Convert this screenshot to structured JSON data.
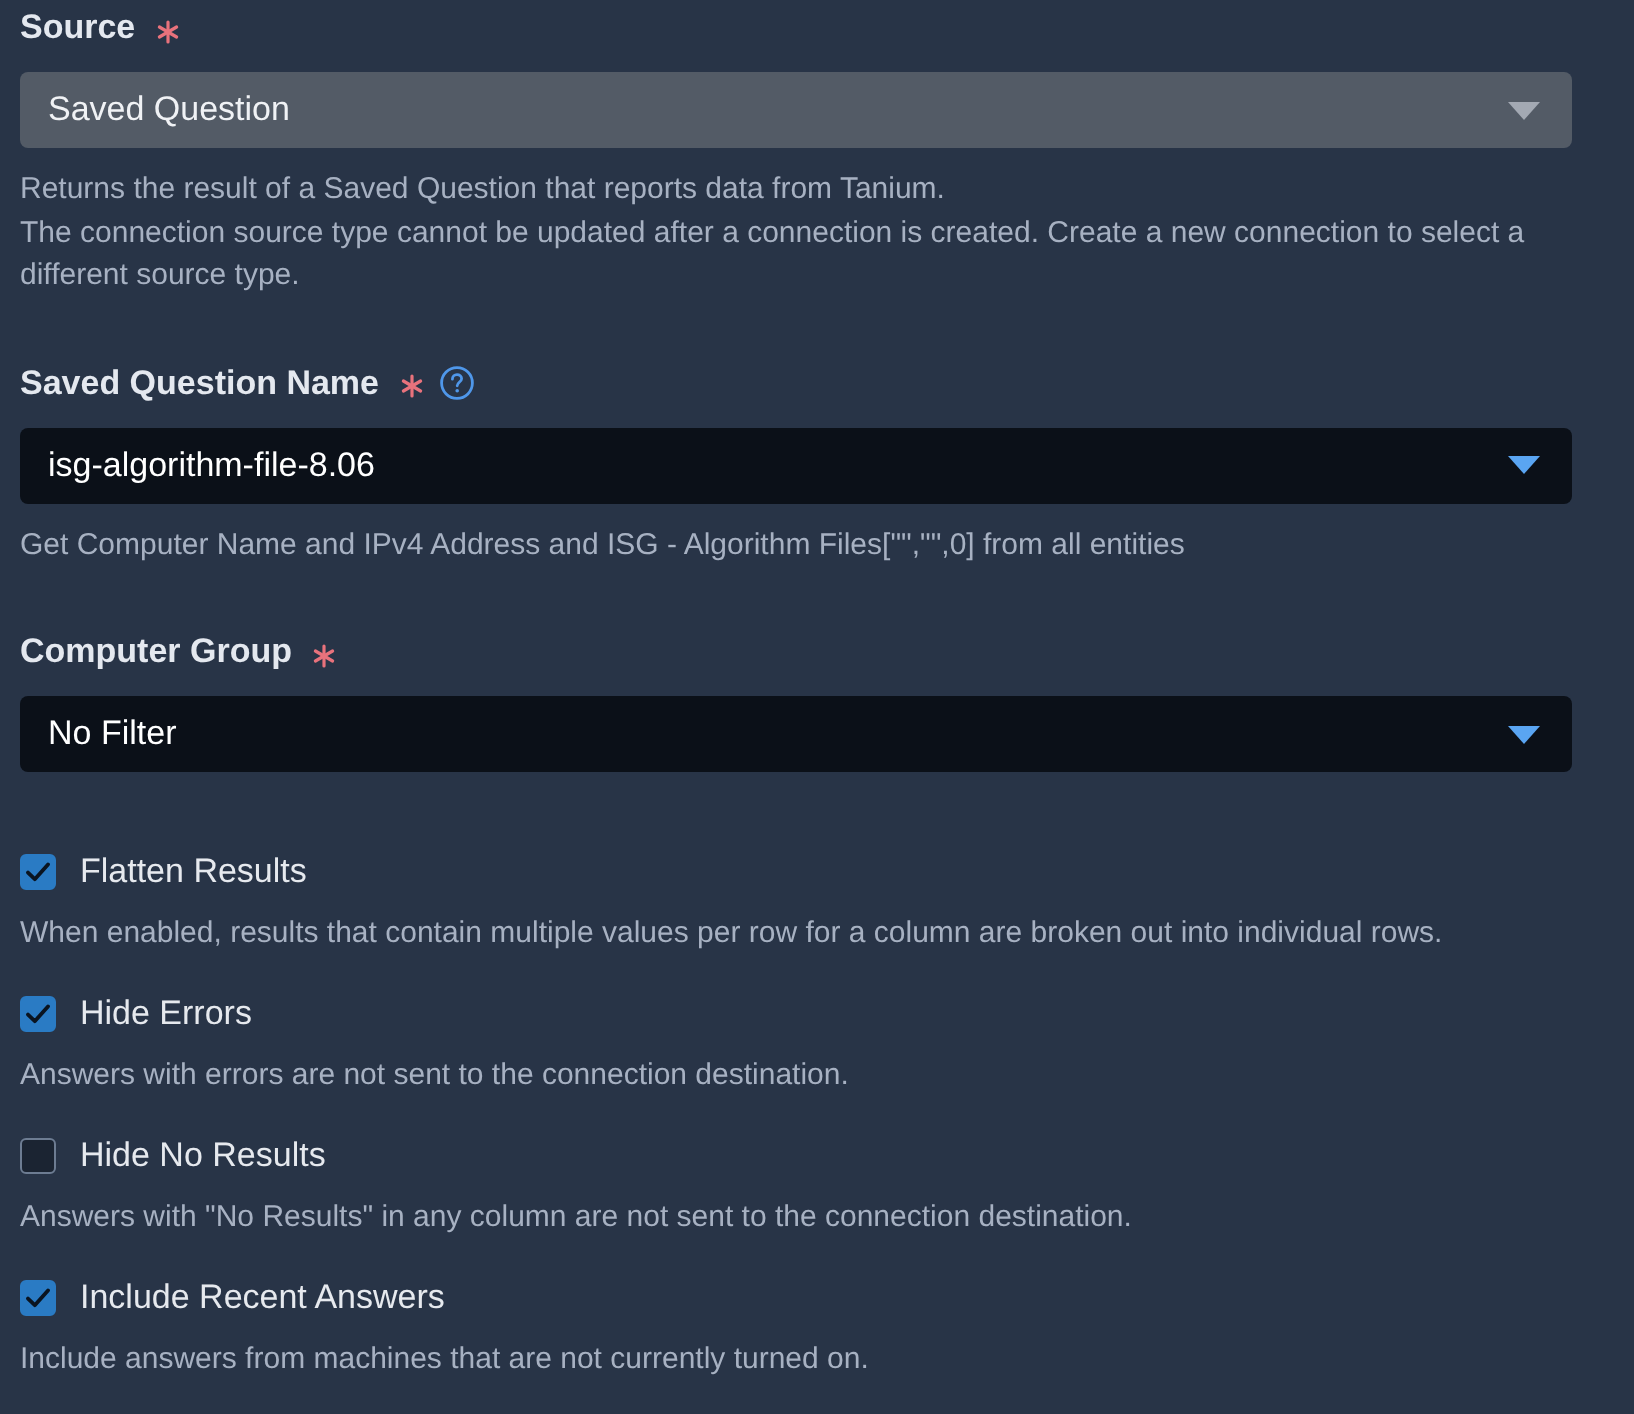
{
  "fields": [
    {
      "label": "Source",
      "required": true,
      "help_icon": false,
      "value": "Saved Question",
      "disabled": true,
      "help": [
        "Returns the result of a Saved Question that reports data from Tanium.",
        "The connection source type cannot be updated after a connection is created. Create a new connection to select a different source type."
      ]
    },
    {
      "label": "Saved Question Name",
      "required": true,
      "help_icon": true,
      "value": "isg-algorithm-file-8.06",
      "disabled": false,
      "help": [
        "Get Computer Name and IPv4 Address and ISG - Algorithm Files[\"\",\"\",0] from all entities"
      ]
    },
    {
      "label": "Computer Group",
      "required": true,
      "help_icon": false,
      "value": "No Filter",
      "disabled": false
    }
  ],
  "options": [
    {
      "label": "Flatten Results",
      "checked": true,
      "help": "When enabled, results that contain multiple values per row for a column are broken out into individual rows."
    },
    {
      "label": "Hide Errors",
      "checked": true,
      "help": "Answers with errors are not sent to the connection destination."
    },
    {
      "label": "Hide No Results",
      "checked": false,
      "help": "Answers with \"No Results\" in any column are not sent to the connection destination."
    },
    {
      "label": "Include Recent Answers",
      "checked": true,
      "help": "Include answers from machines that are not currently turned on."
    }
  ]
}
